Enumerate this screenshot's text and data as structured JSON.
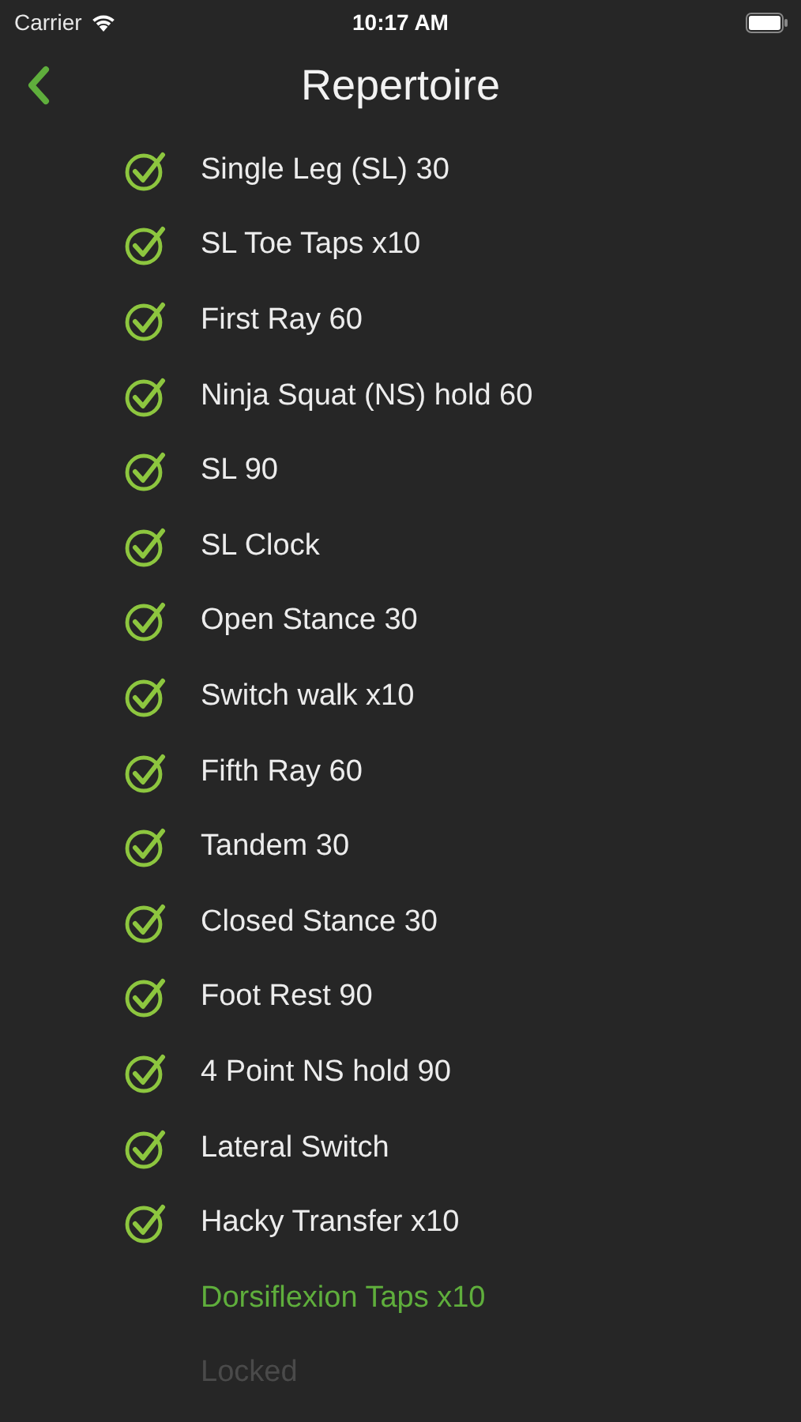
{
  "status_bar": {
    "carrier": "Carrier",
    "time": "10:17 AM"
  },
  "nav": {
    "title": "Repertoire"
  },
  "items": [
    {
      "label": "Single Leg (SL) 30",
      "kind": "done"
    },
    {
      "label": "SL Toe Taps x10",
      "kind": "done"
    },
    {
      "label": "First Ray 60",
      "kind": "done"
    },
    {
      "label": "Ninja Squat (NS) hold 60",
      "kind": "done"
    },
    {
      "label": "SL 90",
      "kind": "done"
    },
    {
      "label": "SL Clock",
      "kind": "done"
    },
    {
      "label": "Open Stance 30",
      "kind": "done"
    },
    {
      "label": "Switch walk x10",
      "kind": "done"
    },
    {
      "label": "Fifth Ray 60",
      "kind": "done"
    },
    {
      "label": "Tandem 30",
      "kind": "done"
    },
    {
      "label": "Closed Stance 30",
      "kind": "done"
    },
    {
      "label": "Foot Rest 90",
      "kind": "done"
    },
    {
      "label": "4 Point NS hold 90",
      "kind": "done"
    },
    {
      "label": "Lateral Switch",
      "kind": "done"
    },
    {
      "label": "Hacky Transfer x10",
      "kind": "done"
    },
    {
      "label": "Dorsiflexion Taps x10",
      "kind": "current"
    },
    {
      "label": "Locked",
      "kind": "locked"
    }
  ]
}
